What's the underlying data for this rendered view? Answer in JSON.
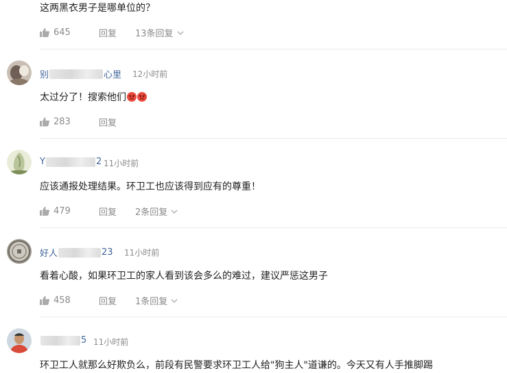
{
  "comments": [
    {
      "content": "这两黑衣男子是哪单位的？",
      "likes": "645",
      "reply_label": "回复",
      "reply_count": "13条回复"
    },
    {
      "name_prefix": "别",
      "name_suffix": "心里",
      "time": "12小时前",
      "content": "太过分了！搜索他们",
      "emoji": [
        "angry-face",
        "angry-face"
      ],
      "likes": "283",
      "reply_label": "回复"
    },
    {
      "name_prefix": "Y",
      "name_suffix": "2",
      "time": "11小时前",
      "content": "应该通报处理结果。环卫工也应该得到应有的尊重！",
      "likes": "479",
      "reply_label": "回复",
      "reply_count": "2条回复"
    },
    {
      "name_prefix": "好人",
      "name_suffix": "23",
      "time": "11小时前",
      "content": "看着心酸，如果环卫工的家人看到该会多么的难过，建议严惩这男子",
      "likes": "458",
      "reply_label": "回复",
      "reply_count": "1条回复"
    },
    {
      "name_prefix": "",
      "name_suffix": "5",
      "time": "11小时前",
      "content": "环卫工人就那么好欺负么，前段有民警要求环卫工人给\"狗主人\"道谦的。今天又有人手推脚踢"
    }
  ],
  "colors": {
    "username": "#406599",
    "meta": "#8a8a8a",
    "text": "#222222",
    "divider": "#ececec"
  },
  "icons": {
    "like": "thumbs-up-icon",
    "expand": "chevron-down-icon"
  }
}
